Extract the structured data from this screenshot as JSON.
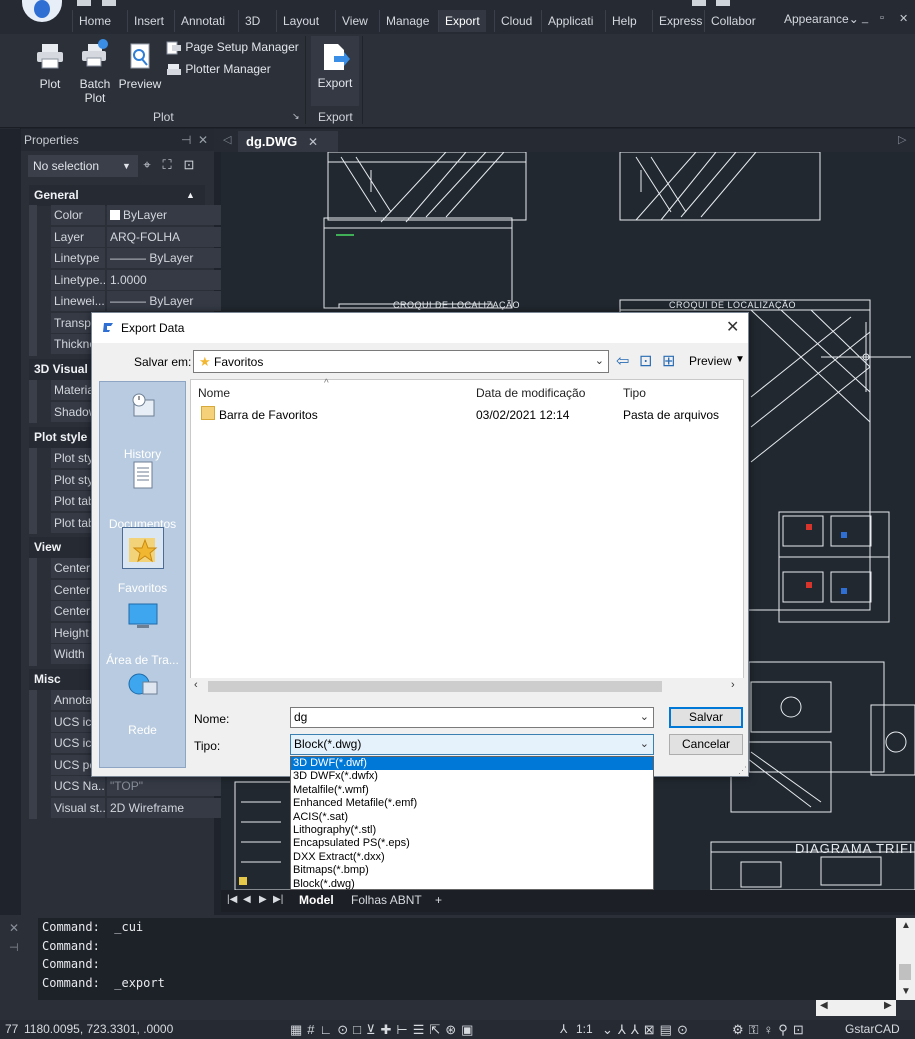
{
  "ribbon": {
    "tabs": [
      "Home",
      "Insert",
      "Annotati",
      "3D",
      "Layout",
      "View",
      "Manage",
      "Export",
      "Cloud",
      "Applicati",
      "Help",
      "Express",
      "Collabor"
    ],
    "active_tab": "Export",
    "appearance": "Appearance",
    "plot_panel": {
      "plot": "Plot",
      "batch_plot": "Batch\nPlot",
      "batch1": "Batch",
      "batch2": "Plot",
      "preview": "Preview",
      "page_setup": "Page Setup Manager",
      "plotter_manager": "Plotter Manager",
      "title": "Plot"
    },
    "export_panel": {
      "export": "Export",
      "title": "Export"
    }
  },
  "left_strip": {
    "a": "F",
    "b": "Pr"
  },
  "properties": {
    "title": "Properties",
    "selection": "No selection",
    "groups": {
      "general": "General",
      "visual3d": "3D Visual",
      "plotstyle": "Plot style",
      "view": "View",
      "misc": "Misc"
    },
    "general_rows": [
      {
        "k": "Color",
        "v": "ByLayer"
      },
      {
        "k": "Layer",
        "v": "ARQ-FOLHA"
      },
      {
        "k": "Linetype",
        "v": "——— ByLayer"
      },
      {
        "k": "Linetype...",
        "v": "1.0000"
      },
      {
        "k": "Linewei...",
        "v": "——— ByLayer"
      },
      {
        "k": "Transpa",
        "v": ""
      },
      {
        "k": "Thickne",
        "v": ""
      }
    ],
    "visual_rows": [
      {
        "k": "Materia"
      },
      {
        "k": "Shadow"
      }
    ],
    "plot_rows": [
      {
        "k": "Plot sty"
      },
      {
        "k": "Plot sty"
      },
      {
        "k": "Plot tab"
      },
      {
        "k": "Plot tab"
      }
    ],
    "view_rows": [
      {
        "k": "Center"
      },
      {
        "k": "Center"
      },
      {
        "k": "Center"
      },
      {
        "k": "Height"
      },
      {
        "k": "Width"
      }
    ],
    "misc_rows": [
      {
        "k": "Annotat",
        "v": ""
      },
      {
        "k": "UCS ico",
        "v": ""
      },
      {
        "k": "UCS ico",
        "v": ""
      },
      {
        "k": "UCS pe",
        "v": ""
      },
      {
        "k": "UCS Na...",
        "v": "\"TOP\""
      },
      {
        "k": "Visual st...",
        "v": "2D Wireframe"
      }
    ]
  },
  "document": {
    "tab": "dg.DWG",
    "layout_tabs": [
      "Model",
      "Folhas ABNT",
      "+"
    ],
    "drawing_texts": {
      "croqui1": "CROQUI DE LOCALIZAÇÃO",
      "croqui2": "CROQUI DE LOCALIZAÇÃO",
      "diagrama": "DIAGRAMA TRIFI"
    }
  },
  "dialog": {
    "title": "Export Data",
    "save_in_label": "Salvar em:",
    "save_in_value": "Favoritos",
    "preview": "Preview",
    "places": [
      "History",
      "Documentos",
      "Favoritos",
      "Área de Tra...",
      "Rede"
    ],
    "columns": {
      "name": "Nome",
      "modified": "Data de modificação",
      "type": "Tipo"
    },
    "files": [
      {
        "name": "Barra de Favoritos",
        "modified": "03/02/2021 12:14",
        "type": "Pasta de arquivos"
      }
    ],
    "name_label": "Nome:",
    "name_value": "dg",
    "type_label": "Tipo:",
    "type_value": "Block(*.dwg)",
    "save_button": "Salvar",
    "cancel_button": "Cancelar",
    "type_options": [
      "3D DWF(*.dwf)",
      "3D DWFx(*.dwfx)",
      "Metalfile(*.wmf)",
      "Enhanced Metafile(*.emf)",
      "ACIS(*.sat)",
      "Lithography(*.stl)",
      "Encapsulated PS(*.eps)",
      "DXX Extract(*.dxx)",
      "Bitmaps(*.bmp)",
      "Block(*.dwg)"
    ]
  },
  "command": {
    "lines": [
      "Command:  _cui",
      "Command:",
      "Command:",
      "Command:  _export"
    ]
  },
  "status": {
    "coords": "1180.0095, 723.3301, .0000",
    "left_num": "77",
    "scale": "1:1",
    "app": "GstarCAD"
  },
  "colors": {
    "accent": "#0078d7",
    "canvas_bg": "#212830",
    "drawing_lines": "#e8ecf0"
  }
}
